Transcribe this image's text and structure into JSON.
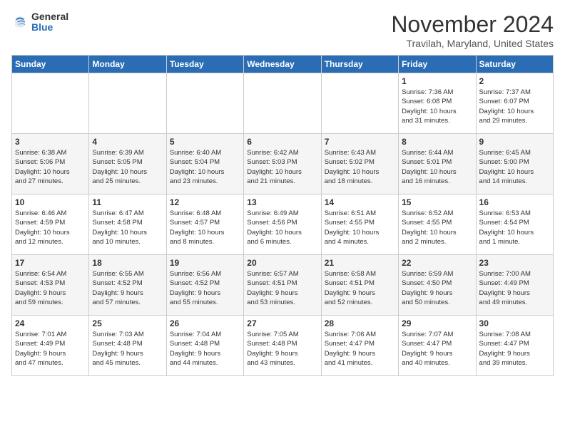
{
  "logo": {
    "general": "General",
    "blue": "Blue"
  },
  "title": "November 2024",
  "location": "Travilah, Maryland, United States",
  "weekdays": [
    "Sunday",
    "Monday",
    "Tuesday",
    "Wednesday",
    "Thursday",
    "Friday",
    "Saturday"
  ],
  "weeks": [
    [
      {
        "day": "",
        "info": ""
      },
      {
        "day": "",
        "info": ""
      },
      {
        "day": "",
        "info": ""
      },
      {
        "day": "",
        "info": ""
      },
      {
        "day": "",
        "info": ""
      },
      {
        "day": "1",
        "info": "Sunrise: 7:36 AM\nSunset: 6:08 PM\nDaylight: 10 hours\nand 31 minutes."
      },
      {
        "day": "2",
        "info": "Sunrise: 7:37 AM\nSunset: 6:07 PM\nDaylight: 10 hours\nand 29 minutes."
      }
    ],
    [
      {
        "day": "3",
        "info": "Sunrise: 6:38 AM\nSunset: 5:06 PM\nDaylight: 10 hours\nand 27 minutes."
      },
      {
        "day": "4",
        "info": "Sunrise: 6:39 AM\nSunset: 5:05 PM\nDaylight: 10 hours\nand 25 minutes."
      },
      {
        "day": "5",
        "info": "Sunrise: 6:40 AM\nSunset: 5:04 PM\nDaylight: 10 hours\nand 23 minutes."
      },
      {
        "day": "6",
        "info": "Sunrise: 6:42 AM\nSunset: 5:03 PM\nDaylight: 10 hours\nand 21 minutes."
      },
      {
        "day": "7",
        "info": "Sunrise: 6:43 AM\nSunset: 5:02 PM\nDaylight: 10 hours\nand 18 minutes."
      },
      {
        "day": "8",
        "info": "Sunrise: 6:44 AM\nSunset: 5:01 PM\nDaylight: 10 hours\nand 16 minutes."
      },
      {
        "day": "9",
        "info": "Sunrise: 6:45 AM\nSunset: 5:00 PM\nDaylight: 10 hours\nand 14 minutes."
      }
    ],
    [
      {
        "day": "10",
        "info": "Sunrise: 6:46 AM\nSunset: 4:59 PM\nDaylight: 10 hours\nand 12 minutes."
      },
      {
        "day": "11",
        "info": "Sunrise: 6:47 AM\nSunset: 4:58 PM\nDaylight: 10 hours\nand 10 minutes."
      },
      {
        "day": "12",
        "info": "Sunrise: 6:48 AM\nSunset: 4:57 PM\nDaylight: 10 hours\nand 8 minutes."
      },
      {
        "day": "13",
        "info": "Sunrise: 6:49 AM\nSunset: 4:56 PM\nDaylight: 10 hours\nand 6 minutes."
      },
      {
        "day": "14",
        "info": "Sunrise: 6:51 AM\nSunset: 4:55 PM\nDaylight: 10 hours\nand 4 minutes."
      },
      {
        "day": "15",
        "info": "Sunrise: 6:52 AM\nSunset: 4:55 PM\nDaylight: 10 hours\nand 2 minutes."
      },
      {
        "day": "16",
        "info": "Sunrise: 6:53 AM\nSunset: 4:54 PM\nDaylight: 10 hours\nand 1 minute."
      }
    ],
    [
      {
        "day": "17",
        "info": "Sunrise: 6:54 AM\nSunset: 4:53 PM\nDaylight: 9 hours\nand 59 minutes."
      },
      {
        "day": "18",
        "info": "Sunrise: 6:55 AM\nSunset: 4:52 PM\nDaylight: 9 hours\nand 57 minutes."
      },
      {
        "day": "19",
        "info": "Sunrise: 6:56 AM\nSunset: 4:52 PM\nDaylight: 9 hours\nand 55 minutes."
      },
      {
        "day": "20",
        "info": "Sunrise: 6:57 AM\nSunset: 4:51 PM\nDaylight: 9 hours\nand 53 minutes."
      },
      {
        "day": "21",
        "info": "Sunrise: 6:58 AM\nSunset: 4:51 PM\nDaylight: 9 hours\nand 52 minutes."
      },
      {
        "day": "22",
        "info": "Sunrise: 6:59 AM\nSunset: 4:50 PM\nDaylight: 9 hours\nand 50 minutes."
      },
      {
        "day": "23",
        "info": "Sunrise: 7:00 AM\nSunset: 4:49 PM\nDaylight: 9 hours\nand 49 minutes."
      }
    ],
    [
      {
        "day": "24",
        "info": "Sunrise: 7:01 AM\nSunset: 4:49 PM\nDaylight: 9 hours\nand 47 minutes."
      },
      {
        "day": "25",
        "info": "Sunrise: 7:03 AM\nSunset: 4:48 PM\nDaylight: 9 hours\nand 45 minutes."
      },
      {
        "day": "26",
        "info": "Sunrise: 7:04 AM\nSunset: 4:48 PM\nDaylight: 9 hours\nand 44 minutes."
      },
      {
        "day": "27",
        "info": "Sunrise: 7:05 AM\nSunset: 4:48 PM\nDaylight: 9 hours\nand 43 minutes."
      },
      {
        "day": "28",
        "info": "Sunrise: 7:06 AM\nSunset: 4:47 PM\nDaylight: 9 hours\nand 41 minutes."
      },
      {
        "day": "29",
        "info": "Sunrise: 7:07 AM\nSunset: 4:47 PM\nDaylight: 9 hours\nand 40 minutes."
      },
      {
        "day": "30",
        "info": "Sunrise: 7:08 AM\nSunset: 4:47 PM\nDaylight: 9 hours\nand 39 minutes."
      }
    ]
  ]
}
